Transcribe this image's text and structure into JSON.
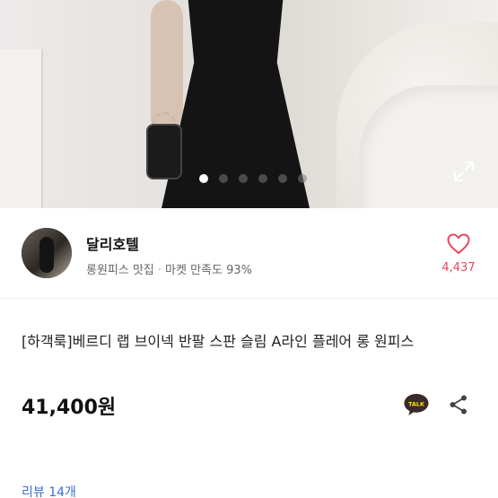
{
  "gallery": {
    "slide_count": 6,
    "active_index": 0,
    "expand_icon": "expand-icon"
  },
  "seller": {
    "name": "달리호텔",
    "category": "롱원피스 맛집",
    "separator": "·",
    "satisfaction": "마켓 만족도 93%"
  },
  "likes": {
    "count": "4,437",
    "icon": "heart-outline-icon",
    "color": "#e8475f"
  },
  "product": {
    "title": "[하객룩]베르디 랩 브이넥 반팔 스판 슬림 A라인 플레어 롱 원피스",
    "price": "41,400원"
  },
  "actions": {
    "talk_label": "TALK",
    "talk_icon": "kakaotalk-icon",
    "share_icon": "share-icon"
  },
  "reviews": {
    "label": "리뷰 14개",
    "color": "#3b6fd6"
  }
}
